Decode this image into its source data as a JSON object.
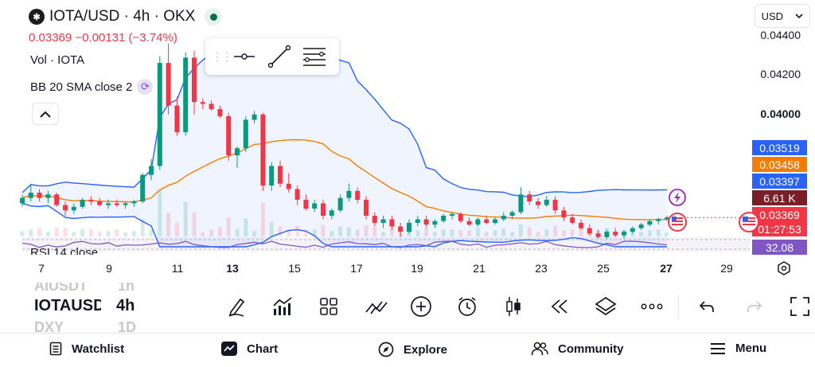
{
  "symbol_header": {
    "title": "IOTA/USD · 4h · OKX",
    "logo_glyph": "✱",
    "status_color": "#0f6e4a"
  },
  "price_change": "0.03369  −0.00131 (−3.74%)",
  "indicators": {
    "volume": "Vol · IOTA",
    "bollinger": "BB 20 SMA close 2",
    "rsi": "RSI 14 close"
  },
  "currency_selector": {
    "value": "USD",
    "icon": "chevron-down-icon"
  },
  "price_axis": {
    "labels": [
      {
        "text": "0.04400",
        "bold": false
      },
      {
        "text": "0.04200",
        "bold": false
      },
      {
        "text": "0.04000",
        "bold": true
      }
    ],
    "tags": [
      {
        "text": "0.03519",
        "color": "#2962ff"
      },
      {
        "text": "0.03458",
        "color": "#f57c00"
      },
      {
        "text": "0.03397",
        "color": "#2962ff"
      },
      {
        "text": "6.61 K",
        "color": "#7a1f27"
      },
      {
        "text": "0.03369",
        "color": "#f23645"
      },
      {
        "text": "01:27:53",
        "color": "#f23645"
      },
      {
        "text": "32.08",
        "color": "#7e57c2"
      }
    ]
  },
  "time_axis": [
    {
      "text": "7",
      "bold": false
    },
    {
      "text": "9",
      "bold": false
    },
    {
      "text": "11",
      "bold": false
    },
    {
      "text": "13",
      "bold": true
    },
    {
      "text": "15",
      "bold": false
    },
    {
      "text": "17",
      "bold": false
    },
    {
      "text": "19",
      "bold": false
    },
    {
      "text": "21",
      "bold": false
    },
    {
      "text": "23",
      "bold": false
    },
    {
      "text": "25",
      "bold": false
    },
    {
      "text": "27",
      "bold": true
    },
    {
      "text": "29",
      "bold": false
    }
  ],
  "watchlist_ghost": {
    "above_symbol": "AIUSDT",
    "above_interval": "1h",
    "below_symbol": "DXY",
    "below_interval": "1D"
  },
  "symbol_selector": {
    "symbol": "IOTAUSD",
    "interval": "4h"
  },
  "toolbar": [
    "draw-pencil-icon",
    "indicators-icon",
    "layouts-icon",
    "compare-icon",
    "add-icon",
    "alert-clock-icon",
    "candles-icon",
    "replay-icon",
    "layers-icon",
    "more-icon",
    "undo-icon",
    "redo-icon",
    "fullscreen-icon"
  ],
  "bottom_nav": [
    {
      "label": "Watchlist",
      "icon": "watchlist-icon"
    },
    {
      "label": "Chart",
      "icon": "chart-icon"
    },
    {
      "label": "Explore",
      "icon": "compass-icon"
    },
    {
      "label": "Community",
      "icon": "community-icon"
    },
    {
      "label": "Menu",
      "icon": "menu-icon"
    }
  ],
  "colors": {
    "up": "#089981",
    "down": "#f23645",
    "bb_band": "#2962ff",
    "bb_basis": "#f57c00",
    "rsi": "#7e57c2"
  },
  "chart_data": {
    "type": "candlestick",
    "ylim": [
      0.0325,
      0.0446
    ],
    "bars": [
      [
        0.0345,
        0.035,
        0.0343,
        0.0348
      ],
      [
        0.0348,
        0.0356,
        0.0346,
        0.0351
      ],
      [
        0.0351,
        0.0353,
        0.0346,
        0.0348
      ],
      [
        0.0348,
        0.0352,
        0.0345,
        0.035
      ],
      [
        0.035,
        0.0351,
        0.0343,
        0.0344
      ],
      [
        0.0344,
        0.0346,
        0.0338,
        0.0341
      ],
      [
        0.0341,
        0.0345,
        0.0339,
        0.0343
      ],
      [
        0.0343,
        0.0348,
        0.0342,
        0.0347
      ],
      [
        0.0347,
        0.0349,
        0.0344,
        0.0346
      ],
      [
        0.0346,
        0.0348,
        0.0343,
        0.0344
      ],
      [
        0.0344,
        0.0347,
        0.0342,
        0.0345
      ],
      [
        0.0345,
        0.0347,
        0.0343,
        0.0344
      ],
      [
        0.0344,
        0.0346,
        0.0342,
        0.0345
      ],
      [
        0.0345,
        0.0347,
        0.0343,
        0.0346
      ],
      [
        0.0346,
        0.0362,
        0.0345,
        0.0361
      ],
      [
        0.0361,
        0.037,
        0.0358,
        0.0366
      ],
      [
        0.0366,
        0.0428,
        0.0364,
        0.0424
      ],
      [
        0.0424,
        0.0435,
        0.0395,
        0.04
      ],
      [
        0.04,
        0.0405,
        0.0383,
        0.0385
      ],
      [
        0.0385,
        0.043,
        0.0383,
        0.0427
      ],
      [
        0.0427,
        0.0431,
        0.0395,
        0.0402
      ],
      [
        0.0402,
        0.0404,
        0.0398,
        0.0401
      ],
      [
        0.0401,
        0.0403,
        0.0397,
        0.0398
      ],
      [
        0.0398,
        0.04,
        0.0393,
        0.0394
      ],
      [
        0.0394,
        0.0396,
        0.0369,
        0.0372
      ],
      [
        0.0372,
        0.0377,
        0.0365,
        0.0376
      ],
      [
        0.0376,
        0.0394,
        0.0374,
        0.0392
      ],
      [
        0.0392,
        0.0397,
        0.039,
        0.0395
      ],
      [
        0.0395,
        0.0396,
        0.0352,
        0.0355
      ],
      [
        0.0355,
        0.0368,
        0.0352,
        0.0366
      ],
      [
        0.0366,
        0.0369,
        0.0354,
        0.0356
      ],
      [
        0.0356,
        0.0362,
        0.0351,
        0.0353
      ],
      [
        0.0353,
        0.0355,
        0.0344,
        0.0347
      ],
      [
        0.0347,
        0.035,
        0.0341,
        0.0342
      ],
      [
        0.0342,
        0.0347,
        0.034,
        0.0345
      ],
      [
        0.0345,
        0.0347,
        0.0336,
        0.0338
      ],
      [
        0.0338,
        0.0342,
        0.0336,
        0.0341
      ],
      [
        0.0341,
        0.035,
        0.034,
        0.0348
      ],
      [
        0.0348,
        0.0356,
        0.0346,
        0.0352
      ],
      [
        0.0352,
        0.0354,
        0.0345,
        0.0347
      ],
      [
        0.0347,
        0.0349,
        0.0336,
        0.0338
      ],
      [
        0.0338,
        0.034,
        0.0332,
        0.0334
      ],
      [
        0.0334,
        0.0338,
        0.0331,
        0.0336
      ],
      [
        0.0336,
        0.0338,
        0.033,
        0.0332
      ],
      [
        0.0332,
        0.0334,
        0.0326,
        0.0329
      ],
      [
        0.0329,
        0.0336,
        0.0328,
        0.0334
      ],
      [
        0.0334,
        0.0338,
        0.0332,
        0.0336
      ],
      [
        0.0336,
        0.0338,
        0.0331,
        0.0333
      ],
      [
        0.0333,
        0.0336,
        0.0331,
        0.0335
      ],
      [
        0.0335,
        0.0339,
        0.0334,
        0.0338
      ],
      [
        0.0338,
        0.034,
        0.0336,
        0.0339
      ],
      [
        0.0339,
        0.034,
        0.0334,
        0.0335
      ],
      [
        0.0335,
        0.0337,
        0.0332,
        0.0333
      ],
      [
        0.0333,
        0.0337,
        0.0332,
        0.0336
      ],
      [
        0.0336,
        0.0338,
        0.0333,
        0.0334
      ],
      [
        0.0334,
        0.0337,
        0.0333,
        0.0336
      ],
      [
        0.0336,
        0.034,
        0.0335,
        0.0338
      ],
      [
        0.0338,
        0.0341,
        0.0336,
        0.034
      ],
      [
        0.034,
        0.0354,
        0.0339,
        0.035
      ],
      [
        0.035,
        0.0352,
        0.0344,
        0.0346
      ],
      [
        0.0346,
        0.0348,
        0.0342,
        0.0344
      ],
      [
        0.0344,
        0.0349,
        0.0343,
        0.0347
      ],
      [
        0.0347,
        0.0349,
        0.0339,
        0.0341
      ],
      [
        0.0341,
        0.0343,
        0.0335,
        0.0337
      ],
      [
        0.0337,
        0.0339,
        0.0333,
        0.0334
      ],
      [
        0.0334,
        0.0336,
        0.033,
        0.0331
      ],
      [
        0.0331,
        0.0333,
        0.0327,
        0.0328
      ],
      [
        0.0328,
        0.033,
        0.0325,
        0.0326
      ],
      [
        0.0326,
        0.033,
        0.0325,
        0.0329
      ],
      [
        0.0329,
        0.0331,
        0.0326,
        0.0327
      ],
      [
        0.0327,
        0.033,
        0.0325,
        0.0329
      ],
      [
        0.0329,
        0.0332,
        0.0328,
        0.0331
      ],
      [
        0.0331,
        0.0334,
        0.033,
        0.0333
      ],
      [
        0.0333,
        0.0336,
        0.0332,
        0.0335
      ],
      [
        0.0335,
        0.0337,
        0.0333,
        0.0336
      ],
      [
        0.0336,
        0.0338,
        0.0335,
        0.0337
      ]
    ]
  }
}
